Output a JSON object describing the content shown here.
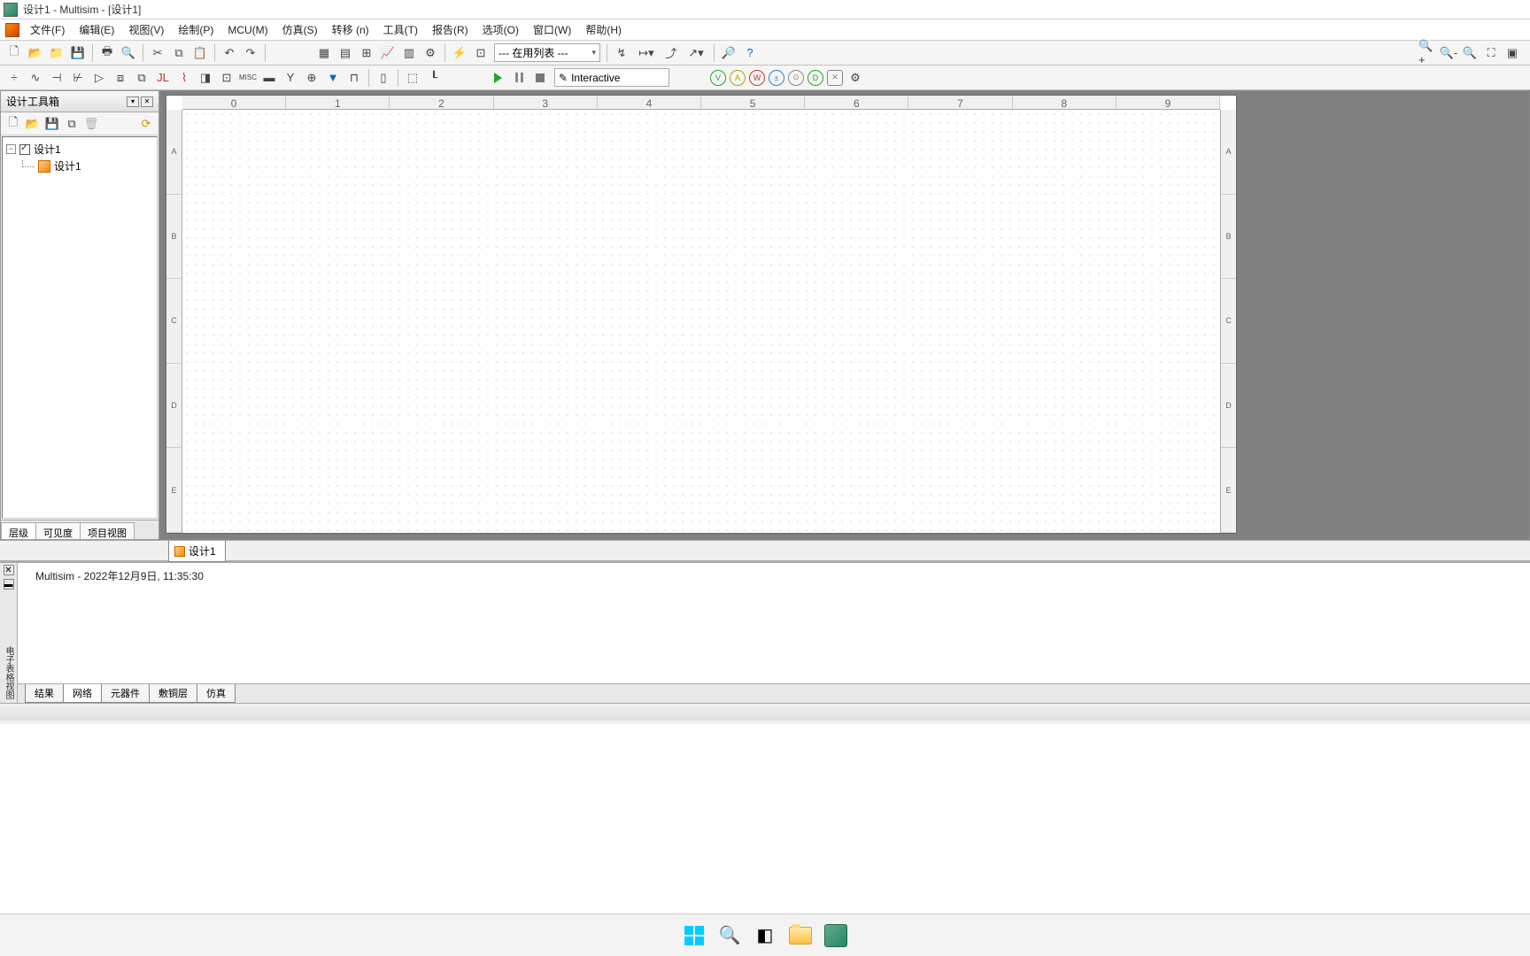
{
  "title": "设计1 - Multisim - [设计1]",
  "menu": [
    "文件(F)",
    "编辑(E)",
    "视图(V)",
    "绘制(P)",
    "MCU(M)",
    "仿真(S)",
    "转移 (n)",
    "工具(T)",
    "报告(R)",
    "选项(O)",
    "窗口(W)",
    "帮助(H)"
  ],
  "combo_in_use": "--- 在用列表 ---",
  "interactive_label": "Interactive",
  "sidebar_title": "设计工具箱",
  "tree_root": "设计1",
  "tree_child": "设计1",
  "sidebar_tabs": {
    "t1": "层级",
    "t2": "可见度",
    "t3": "项目视图"
  },
  "ruler_h": [
    "0",
    "1",
    "2",
    "3",
    "4",
    "5",
    "6",
    "7",
    "8",
    "9"
  ],
  "ruler_v": [
    "A",
    "B",
    "C",
    "D",
    "E"
  ],
  "doc_tab": "设计1",
  "log_line": "Multisim  -  2022年12月9日, 11:35:30",
  "log_side_label": "电子表格视图",
  "log_tabs": {
    "t1": "结果",
    "t2": "网络",
    "t3": "元器件",
    "t4": "敷铜层",
    "t5": "仿真"
  }
}
